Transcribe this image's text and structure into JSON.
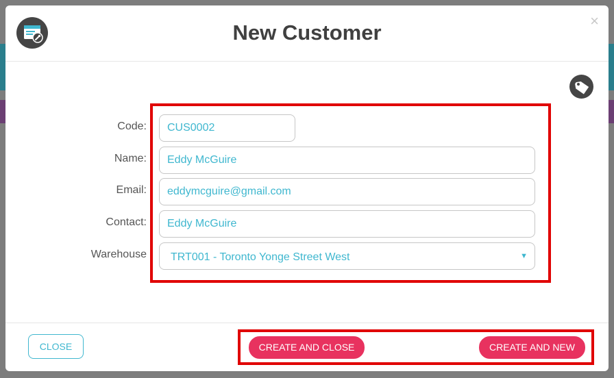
{
  "modal": {
    "title": "New Customer",
    "close_x": "×"
  },
  "form": {
    "code": {
      "label": "Code:",
      "value": "CUS0002"
    },
    "name": {
      "label": "Name:",
      "value": "Eddy McGuire"
    },
    "email": {
      "label": "Email:",
      "value": "eddymcguire@gmail.com"
    },
    "contact": {
      "label": "Contact:",
      "value": "Eddy McGuire"
    },
    "warehouse": {
      "label": "Warehouse",
      "value": "TRT001 - Toronto Yonge Street West",
      "caret": "▼"
    }
  },
  "footer": {
    "close_label": "CLOSE",
    "create_close_label": "CREATE AND CLOSE",
    "create_new_label": "CREATE AND NEW"
  },
  "icons": {
    "app": "window-settings-icon",
    "tag": "tag-icon"
  },
  "colors": {
    "accent": "#3fb7cf",
    "primary_button": "#e8325f",
    "highlight": "#e00000",
    "title": "#404040"
  }
}
